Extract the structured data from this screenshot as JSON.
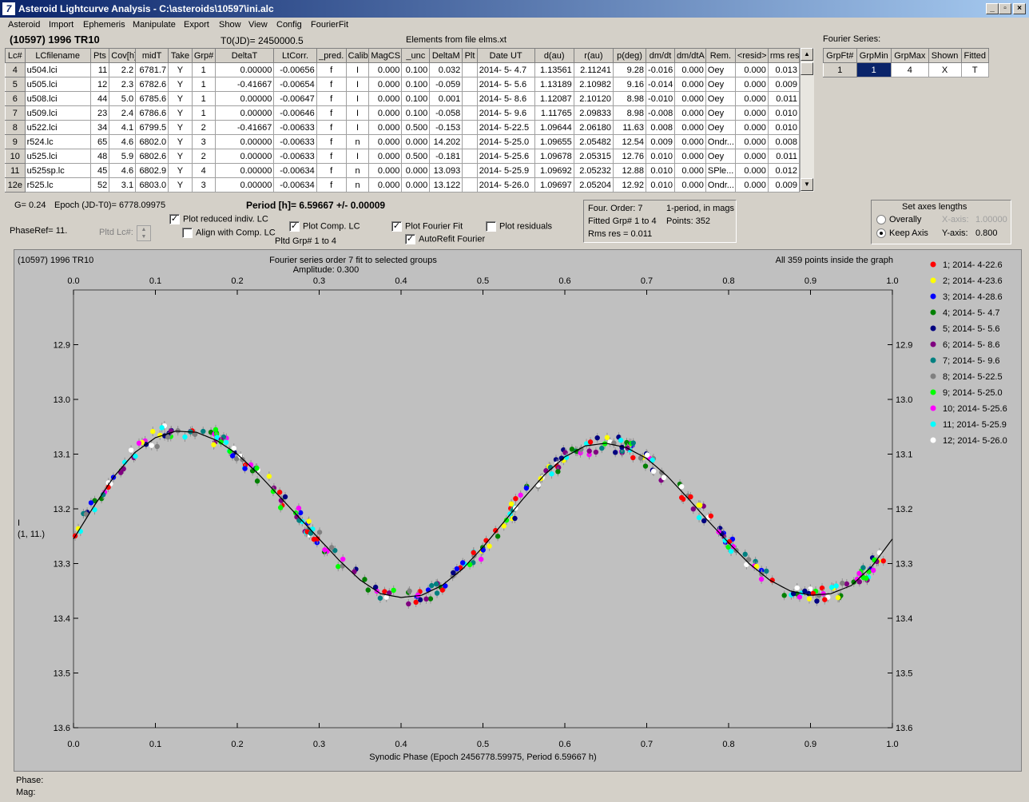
{
  "window": {
    "title": "Asteroid Lightcurve Analysis - C:\\asteroids\\10597\\ini.alc",
    "buttons": [
      "_",
      "▫",
      "×"
    ]
  },
  "menu": [
    "Asteroid",
    "Import",
    "Ephemeris",
    "Manipulate",
    "Export",
    "Show",
    "View",
    "Config",
    "FourierFit"
  ],
  "header": {
    "asteroid": "(10597) 1996 TR10",
    "t0": "T0(JD)= 2450000.5",
    "elements": "Elements from file elms.xt"
  },
  "table": {
    "columns": [
      "Lc#",
      "LCfilename",
      "Pts",
      "Cov[h]",
      "midT",
      "Take",
      "Grp#",
      "DeltaT",
      "LtCorr.",
      "_pred.",
      "Calib",
      "MagCS",
      "_unc",
      "DeltaM",
      "Plt",
      "Date UT",
      "d(au)",
      "r(au)",
      "p(deg)",
      "dm/dt",
      "dm/dtA",
      "Rem.",
      "<resid>",
      "rms res"
    ],
    "rows": [
      [
        "4",
        "u504.lci",
        "11",
        "2.2",
        "6781.7",
        "Y",
        "1",
        "0.00000",
        "-0.00656",
        "f",
        "I",
        "0.000",
        "0.100",
        "0.032",
        "",
        "2014- 5- 4.7",
        "1.13561",
        "2.11241",
        "9.28",
        "-0.016",
        "0.000",
        "Oey",
        "0.000",
        "0.013"
      ],
      [
        "5",
        "u505.lci",
        "12",
        "2.3",
        "6782.6",
        "Y",
        "1",
        "-0.41667",
        "-0.00654",
        "f",
        "I",
        "0.000",
        "0.100",
        "-0.059",
        "",
        "2014- 5- 5.6",
        "1.13189",
        "2.10982",
        "9.16",
        "-0.014",
        "0.000",
        "Oey",
        "0.000",
        "0.009"
      ],
      [
        "6",
        "u508.lci",
        "44",
        "5.0",
        "6785.6",
        "Y",
        "1",
        "0.00000",
        "-0.00647",
        "f",
        "I",
        "0.000",
        "0.100",
        "0.001",
        "",
        "2014- 5- 8.6",
        "1.12087",
        "2.10120",
        "8.98",
        "-0.010",
        "0.000",
        "Oey",
        "0.000",
        "0.011"
      ],
      [
        "7",
        "u509.lci",
        "23",
        "2.4",
        "6786.6",
        "Y",
        "1",
        "0.00000",
        "-0.00646",
        "f",
        "I",
        "0.000",
        "0.100",
        "-0.058",
        "",
        "2014- 5- 9.6",
        "1.11765",
        "2.09833",
        "8.98",
        "-0.008",
        "0.000",
        "Oey",
        "0.000",
        "0.010"
      ],
      [
        "8",
        "u522.lci",
        "34",
        "4.1",
        "6799.5",
        "Y",
        "2",
        "-0.41667",
        "-0.00633",
        "f",
        "I",
        "0.000",
        "0.500",
        "-0.153",
        "",
        "2014- 5-22.5",
        "1.09644",
        "2.06180",
        "11.63",
        "0.008",
        "0.000",
        "Oey",
        "0.000",
        "0.010"
      ],
      [
        "9",
        "r524.lc",
        "65",
        "4.6",
        "6802.0",
        "Y",
        "3",
        "0.00000",
        "-0.00633",
        "f",
        "n",
        "0.000",
        "0.000",
        "14.202",
        "",
        "2014- 5-25.0",
        "1.09655",
        "2.05482",
        "12.54",
        "0.009",
        "0.000",
        "Ondr...",
        "0.000",
        "0.008"
      ],
      [
        "10",
        "u525.lci",
        "48",
        "5.9",
        "6802.6",
        "Y",
        "2",
        "0.00000",
        "-0.00633",
        "f",
        "I",
        "0.000",
        "0.500",
        "-0.181",
        "",
        "2014- 5-25.6",
        "1.09678",
        "2.05315",
        "12.76",
        "0.010",
        "0.000",
        "Oey",
        "0.000",
        "0.011"
      ],
      [
        "11",
        "u525sp.lc",
        "45",
        "4.6",
        "6802.9",
        "Y",
        "4",
        "0.00000",
        "-0.00634",
        "f",
        "n",
        "0.000",
        "0.000",
        "13.093",
        "",
        "2014- 5-25.9",
        "1.09692",
        "2.05232",
        "12.88",
        "0.010",
        "0.000",
        "SPle...",
        "0.000",
        "0.012"
      ],
      [
        "12e",
        "r525.lc",
        "52",
        "3.1",
        "6803.0",
        "Y",
        "3",
        "0.00000",
        "-0.00634",
        "f",
        "n",
        "0.000",
        "0.000",
        "13.122",
        "",
        "2014- 5-26.0",
        "1.09697",
        "2.05204",
        "12.92",
        "0.010",
        "0.000",
        "Ondr...",
        "0.000",
        "0.009"
      ]
    ]
  },
  "fourier_table": {
    "title": "Fourier Series:",
    "columns": [
      "GrpFt#",
      "GrpMin",
      "GrpMax",
      "Shown",
      "Fitted"
    ],
    "row": [
      "1",
      "1",
      "4",
      "X",
      "T"
    ]
  },
  "controls": {
    "g": "G= 0.24",
    "epoch": "Epoch (JD-T0)= 6778.09975",
    "phaseref": "PhaseRef= 11.",
    "pltd_lc": "Pltd Lc#:",
    "period": "Period [h]= 6.59667 +/- 0.00009",
    "plot_reduced": "Plot reduced indiv. LC",
    "align_comp": "Align with Comp. LC",
    "plot_comp": "Plot Comp. LC",
    "pltd_grp": "Pltd Grp#  1   to   4",
    "plot_fourier": "Plot Fourier Fit",
    "autorefit": "AutoRefit Fourier",
    "plot_residuals": "Plot residuals"
  },
  "fourier_info": {
    "order": "Four. Order:  7",
    "period_mode": "1-period, in mags",
    "fitted": "Fitted Grp# 1 to 4",
    "points": "Points: 352",
    "rms": "Rms res     = 0.011"
  },
  "axes_box": {
    "title": "Set axes lengths",
    "overally": "Overally",
    "keep": "Keep Axis",
    "x_label": "X-axis:",
    "x_value": "1.00000",
    "y_label": "Y-axis:",
    "y_value": "0.800"
  },
  "plot_header": {
    "left": "(10597) 1996 TR10",
    "center": "Fourier series order 7 fit to selected groups",
    "amplitude": "Amplitude: 0.300",
    "right": "All 359 points inside the graph",
    "ylabel": "I",
    "ylabel2": "(1, 11.)"
  },
  "chart_data": {
    "type": "scatter",
    "xlabel": "Synodic Phase (Epoch 2456778.59975, Period 6.59667 h)",
    "xlim": [
      0.0,
      1.0
    ],
    "ylim": [
      13.6,
      12.8
    ],
    "y_inverted": true,
    "x_ticks": [
      "0.0",
      "0.1",
      "0.2",
      "0.3",
      "0.4",
      "0.5",
      "0.6",
      "0.7",
      "0.8",
      "0.9",
      "1.0"
    ],
    "y_ticks": [
      "12.9",
      "13.0",
      "13.1",
      "13.2",
      "13.3",
      "13.4",
      "13.5",
      "13.6"
    ],
    "fit_curve": {
      "x": [
        0.0,
        0.025,
        0.05,
        0.075,
        0.1,
        0.125,
        0.15,
        0.175,
        0.2,
        0.225,
        0.25,
        0.275,
        0.3,
        0.325,
        0.35,
        0.375,
        0.4,
        0.425,
        0.45,
        0.475,
        0.5,
        0.525,
        0.55,
        0.575,
        0.6,
        0.625,
        0.65,
        0.675,
        0.7,
        0.725,
        0.75,
        0.775,
        0.8,
        0.825,
        0.85,
        0.875,
        0.9,
        0.925,
        0.95,
        0.975,
        1.0
      ],
      "y": [
        13.255,
        13.195,
        13.14,
        13.097,
        13.07,
        13.058,
        13.06,
        13.075,
        13.1,
        13.135,
        13.175,
        13.215,
        13.255,
        13.295,
        13.33,
        13.355,
        13.362,
        13.358,
        13.34,
        13.31,
        13.27,
        13.225,
        13.18,
        13.138,
        13.105,
        13.085,
        13.08,
        13.088,
        13.108,
        13.14,
        13.18,
        13.222,
        13.262,
        13.3,
        13.33,
        13.35,
        13.358,
        13.355,
        13.34,
        13.305,
        13.255
      ]
    },
    "series": [
      {
        "name": "1; 2014- 4-22.6",
        "color": "#ff0000"
      },
      {
        "name": "2; 2014- 4-23.6",
        "color": "#ffff00"
      },
      {
        "name": "3; 2014- 4-28.6",
        "color": "#0000ff"
      },
      {
        "name": "4; 2014- 5- 4.7",
        "color": "#008000"
      },
      {
        "name": "5; 2014- 5- 5.6",
        "color": "#000080"
      },
      {
        "name": "6; 2014- 5- 8.6",
        "color": "#800080"
      },
      {
        "name": "7; 2014- 5- 9.6",
        "color": "#008080"
      },
      {
        "name": "8; 2014- 5-22.5",
        "color": "#808080"
      },
      {
        "name": "9; 2014- 5-25.0",
        "color": "#00ff00"
      },
      {
        "name": "10; 2014- 5-25.6",
        "color": "#ff00ff"
      },
      {
        "name": "11; 2014- 5-25.9",
        "color": "#00ffff"
      },
      {
        "name": "12; 2014- 5-26.0",
        "color": "#ffffff"
      }
    ]
  },
  "status": {
    "phase": "Phase:",
    "mag": "Mag:"
  }
}
